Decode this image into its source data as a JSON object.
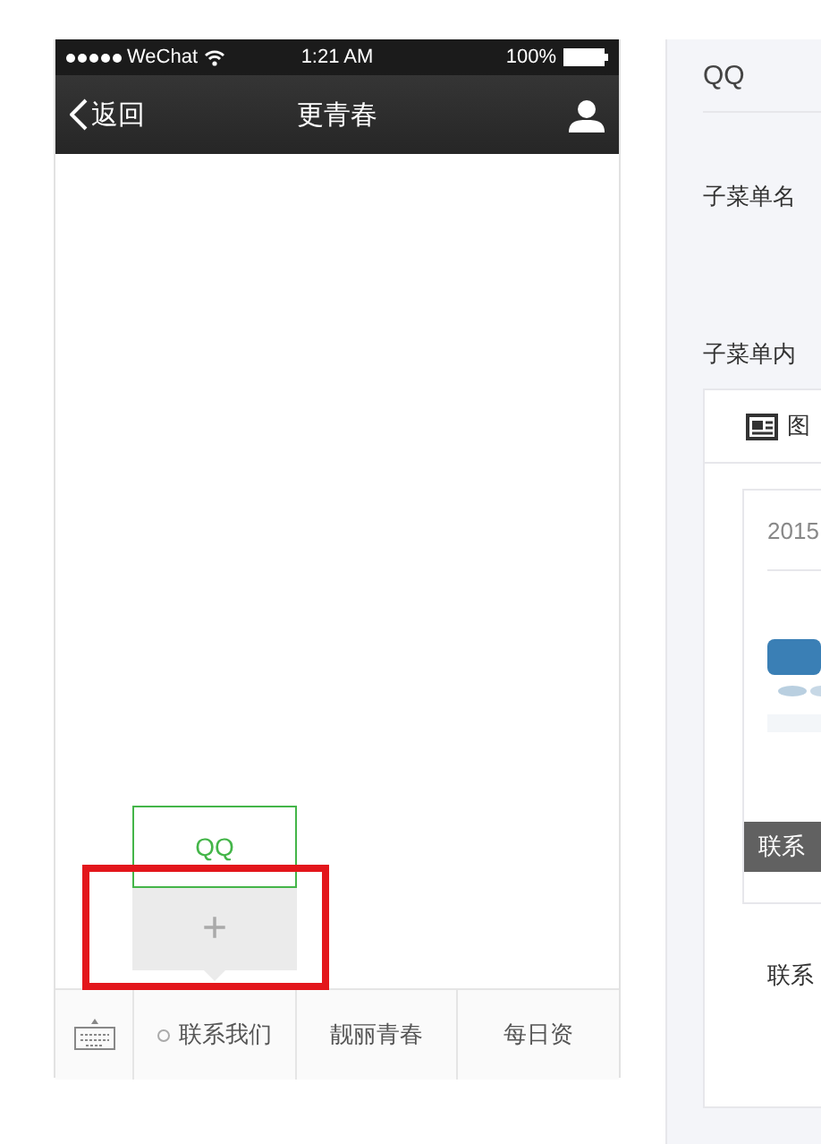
{
  "phone": {
    "status_bar": {
      "carrier": "WeChat",
      "time": "1:21 AM",
      "battery": "100%"
    },
    "nav": {
      "back": "返回",
      "title": "更青春"
    },
    "submenu": {
      "items": [
        {
          "label": "QQ",
          "selected": true
        }
      ],
      "add": "+",
      "highlighted": true
    },
    "menu": {
      "items": [
        {
          "label": "联系我们",
          "has_submenu": true
        },
        {
          "label": "靓丽青春",
          "has_submenu": false
        },
        {
          "label": "每日资",
          "has_submenu": false
        }
      ]
    }
  },
  "editor": {
    "name_value": "QQ",
    "name_label": "子菜单名",
    "content_label": "子菜单内",
    "tab": "图",
    "article": {
      "date": "2015",
      "tag": "联系",
      "footer": "联系"
    }
  }
}
